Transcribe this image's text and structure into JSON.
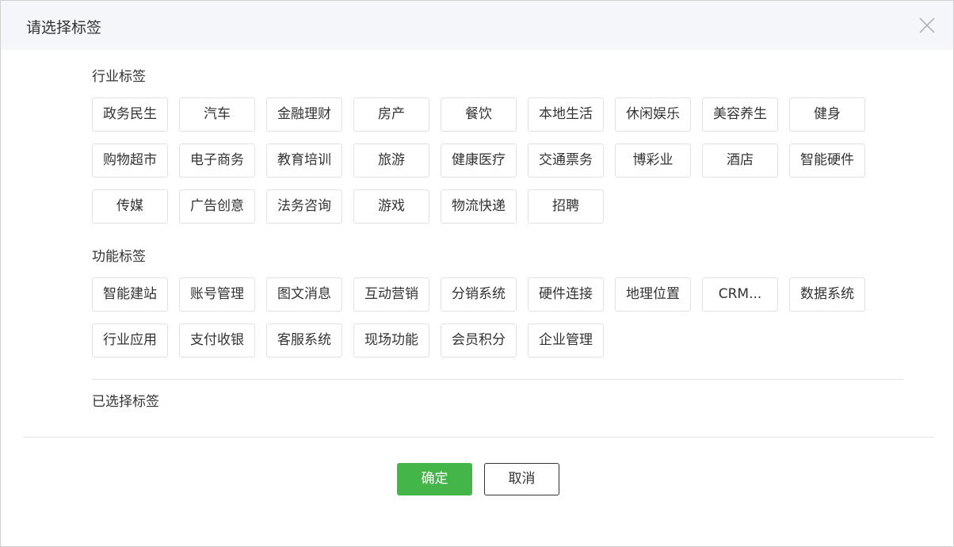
{
  "dialog": {
    "title": "请选择标签",
    "close_icon": "close-icon"
  },
  "industry": {
    "title": "行业标签",
    "tags": [
      "政务民生",
      "汽车",
      "金融理财",
      "房产",
      "餐饮",
      "本地生活",
      "休闲娱乐",
      "美容养生",
      "健身",
      "购物超市",
      "电子商务",
      "教育培训",
      "旅游",
      "健康医疗",
      "交通票务",
      "博彩业",
      "酒店",
      "智能硬件",
      "传媒",
      "广告创意",
      "法务咨询",
      "游戏",
      "物流快递",
      "招聘"
    ]
  },
  "function": {
    "title": "功能标签",
    "tags": [
      "智能建站",
      "账号管理",
      "图文消息",
      "互动营销",
      "分销系统",
      "硬件连接",
      "地理位置",
      "CRM...",
      "数据系统",
      "行业应用",
      "支付收银",
      "客服系统",
      "现场功能",
      "会员积分",
      "企业管理"
    ]
  },
  "selected": {
    "title": "已选择标签"
  },
  "footer": {
    "confirm_label": "确定",
    "cancel_label": "取消"
  },
  "colors": {
    "accent": "#44b549",
    "header_bg": "#f4f6f9"
  }
}
